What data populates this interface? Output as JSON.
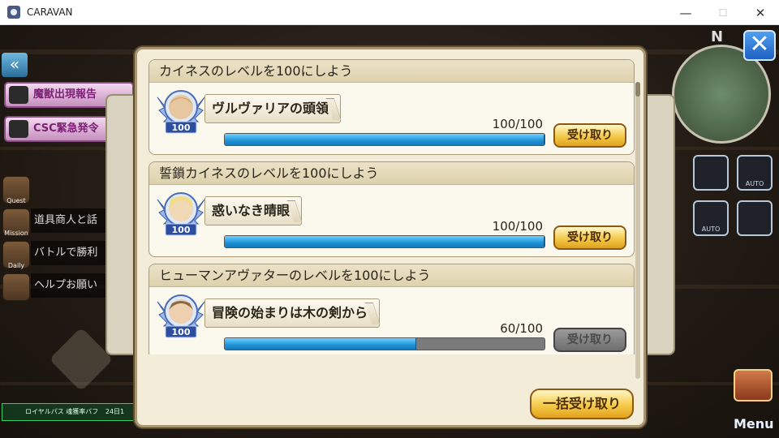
{
  "window": {
    "title": "CARAVAN",
    "min_glyph": "—",
    "max_glyph": "☐",
    "close_glyph": "✕"
  },
  "hud_left": {
    "banners": [
      "魔獣出現報告",
      "CSC緊急発令"
    ],
    "buttons": [
      "Quest",
      "Mission",
      "Daily"
    ],
    "strips": [
      "道具商人と話",
      "バトルで勝利",
      "ヘルプお願い"
    ],
    "royal_pass": "ロイヤルパス 魂獲率バフ",
    "royal_time": "24日1"
  },
  "hud_right": {
    "auto_label": "AUTO",
    "menu_label": "Menu",
    "corner_label": "N"
  },
  "dialog": {
    "close_glyph": "✕",
    "claim_all_label": "一括受け取り",
    "missions": [
      {
        "title": "カイネスのレベルを100にしよう",
        "reward": "ヴルヴァリアの頭領",
        "level_badge": "100",
        "progress_text": "100/100",
        "progress_ratio": 1.0,
        "claim_label": "受け取り",
        "claimable": true
      },
      {
        "title": "誓鎖カイネスのレベルを100にしよう",
        "reward": "惑いなき晴眼",
        "level_badge": "100",
        "progress_text": "100/100",
        "progress_ratio": 1.0,
        "claim_label": "受け取り",
        "claimable": true
      },
      {
        "title": "ヒューマンアヴァターのレベルを100にしよう",
        "reward": "冒険の始まりは木の剣から",
        "level_badge": "100",
        "progress_text": "60/100",
        "progress_ratio": 0.6,
        "claim_label": "受け取り",
        "claimable": false
      }
    ]
  },
  "colors": {
    "progress_fill": "#1e92d8",
    "claim_gold": "#f4c94a",
    "claim_disabled": "#7a7a7a",
    "close_blue": "#2f7fd8"
  }
}
